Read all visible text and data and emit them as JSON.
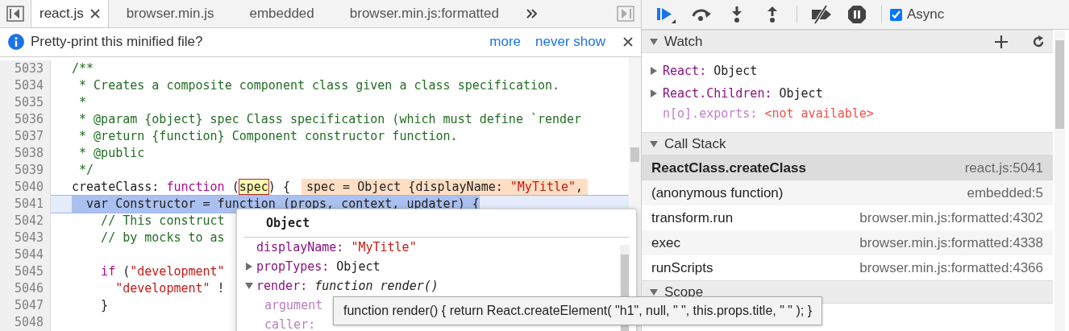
{
  "tabs": [
    {
      "label": "react.js",
      "selected": true,
      "closable": true
    },
    {
      "label": "browser.min.js",
      "selected": false,
      "closable": false
    },
    {
      "label": "embedded",
      "selected": false,
      "closable": false
    },
    {
      "label": "browser.min.js:formatted",
      "selected": false,
      "closable": false
    }
  ],
  "infobar": {
    "message": "Pretty-print this minified file?",
    "links": [
      "more",
      "never show"
    ]
  },
  "code": {
    "lines": [
      {
        "number": "5033",
        "selected": false,
        "tokens": [
          {
            "kind": "comment",
            "text": "/**"
          }
        ]
      },
      {
        "number": "5034",
        "selected": false,
        "tokens": [
          {
            "kind": "comment",
            "text": " * Creates a composite component class given a class specification."
          }
        ]
      },
      {
        "number": "5035",
        "selected": false,
        "tokens": [
          {
            "kind": "comment",
            "text": " *"
          }
        ]
      },
      {
        "number": "5036",
        "selected": false,
        "tokens": [
          {
            "kind": "comment",
            "text": " * @param {object} spec Class specification (which must define `render"
          }
        ]
      },
      {
        "number": "5037",
        "selected": false,
        "tokens": [
          {
            "kind": "comment",
            "text": " * @return {function} Component constructor function."
          }
        ]
      },
      {
        "number": "5038",
        "selected": false,
        "tokens": [
          {
            "kind": "comment",
            "text": " * @public"
          }
        ]
      },
      {
        "number": "5039",
        "selected": false,
        "tokens": [
          {
            "kind": "comment",
            "text": " */"
          }
        ]
      },
      {
        "number": "5040",
        "selected": false,
        "tokens": [
          {
            "kind": "plain",
            "text": "createClass: "
          },
          {
            "kind": "keyword",
            "text": "function"
          },
          {
            "kind": "plain",
            "text": " ("
          },
          {
            "kind": "boxed",
            "text": "spec"
          },
          {
            "kind": "plain",
            "text": ") {"
          }
        ],
        "inline_value": [
          {
            "kind": "plain",
            "text": "spec = Object {displayName: "
          },
          {
            "kind": "string",
            "text": "\"MyTitle\""
          },
          {
            "kind": "plain",
            "text": ","
          }
        ]
      },
      {
        "number": "5041",
        "selected": true,
        "tokens": [
          {
            "kind": "plain",
            "text": "  var Constructor = function (props, context, updater) {"
          }
        ]
      },
      {
        "number": "5042",
        "selected": false,
        "tokens": [
          {
            "kind": "comment",
            "text": "    // This construct"
          }
        ]
      },
      {
        "number": "5043",
        "selected": false,
        "tokens": [
          {
            "kind": "comment",
            "text": "    // by mocks to as"
          }
        ]
      },
      {
        "number": "5044",
        "selected": false
      },
      {
        "number": "5045",
        "selected": false,
        "tokens": [
          {
            "kind": "keyword",
            "text": "    if"
          },
          {
            "kind": "plain",
            "text": " ("
          },
          {
            "kind": "string",
            "text": "\"development\""
          }
        ]
      },
      {
        "number": "5046",
        "selected": false,
        "tokens": [
          {
            "kind": "string",
            "text": "      \"development\""
          },
          {
            "kind": "plain",
            "text": " !"
          }
        ]
      },
      {
        "number": "5047",
        "selected": false,
        "tokens": [
          {
            "kind": "plain",
            "text": "    }"
          }
        ]
      },
      {
        "number": "5048",
        "selected": false
      }
    ]
  },
  "popover": {
    "title": "Object",
    "properties": [
      {
        "name": "displayName:",
        "value": "\"MyTitle\"",
        "kind": "string"
      },
      {
        "name": "propTypes:",
        "value": "Object",
        "kind": "object",
        "expanded": false
      },
      {
        "name": "render:",
        "value": "function render()",
        "kind": "function",
        "expanded": true,
        "children": [
          "argument",
          "caller:"
        ]
      }
    ]
  },
  "tooltip": "function render() { return React.createElement( \"h1\", null, \" \", this.props.title, \" \" ); }",
  "debugger_toolbar": {
    "async": {
      "label": "Async",
      "checked": true
    }
  },
  "watch": {
    "title": "Watch",
    "expanded": true,
    "items": [
      {
        "name": "React:",
        "value": "Object",
        "available": true,
        "expanded": false
      },
      {
        "name": "React.Children:",
        "value": "Object",
        "available": true,
        "expanded": false
      },
      {
        "name": "n[o].exports:",
        "value": "<not available>",
        "available": false
      }
    ]
  },
  "call_stack": {
    "title": "Call Stack",
    "expanded": true,
    "frames": [
      {
        "function": "ReactClass.createClass",
        "location": "react.js:5041",
        "selected": true
      },
      {
        "function": "(anonymous function)",
        "location": "embedded:5",
        "selected": false
      },
      {
        "function": "transform.run",
        "location": "browser.min.js:formatted:4302",
        "selected": false
      },
      {
        "function": "exec",
        "location": "browser.min.js:formatted:4338",
        "selected": false
      },
      {
        "function": "runScripts",
        "location": "browser.min.js:formatted:4366",
        "selected": false
      }
    ]
  },
  "scope": {
    "title": "Scope",
    "expanded": true
  }
}
